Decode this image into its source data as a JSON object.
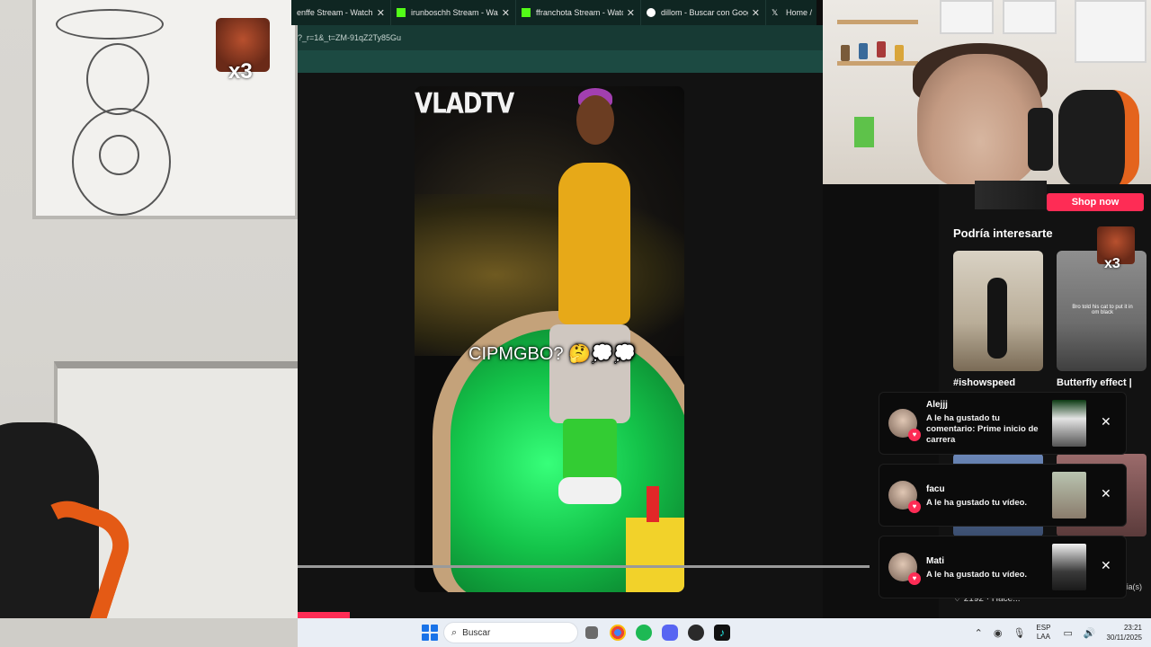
{
  "browser": {
    "tabs": [
      {
        "label": "enffe Stream - Watch Li",
        "icon": "kick-favicon"
      },
      {
        "label": "irunboschh Stream - Watc",
        "icon": "kick-favicon"
      },
      {
        "label": "ffranchota Stream - Watc",
        "icon": "kick-favicon"
      },
      {
        "label": "dillom - Buscar con Goog",
        "icon": "google-favicon"
      },
      {
        "label": "Home / X",
        "icon": "x-favicon"
      }
    ],
    "url": "?_r=1&_t=ZM-91qZ2Ty85Gu"
  },
  "video": {
    "watermark": "VLADTV",
    "caption": "CIPMGBO? 🤔💭💭"
  },
  "overlay": {
    "emote_multiplier": "x3"
  },
  "right_panel": {
    "shop_button": "Shop now",
    "recommend_title": "Podría interesarte",
    "recommendations": [
      {
        "label": "#ishowspeed"
      },
      {
        "label": "Butterfly effect |"
      }
    ],
    "card_caption": "Bro told his cat to put it in om black",
    "emote_multiplier": "x3",
    "like_row": "♡ 2192 · Hace...",
    "side_text": "ía(s)"
  },
  "notifications": [
    {
      "name": "Alejjj",
      "message": "A le ha gustado tu comentario: Prime inicio de carrera"
    },
    {
      "name": "facu",
      "message": "A le ha gustado tu vídeo."
    },
    {
      "name": "Mati",
      "message": "A le ha gustado tu vídeo."
    }
  ],
  "taskbar": {
    "search_label": "Buscar",
    "lang_line1": "ESP",
    "lang_line2": "LAA",
    "time": "23:21",
    "date": "30/11/2025"
  },
  "colors": {
    "accent": "#fe2c55",
    "tabbar": "#0f2622",
    "urlbar": "#173a34"
  }
}
